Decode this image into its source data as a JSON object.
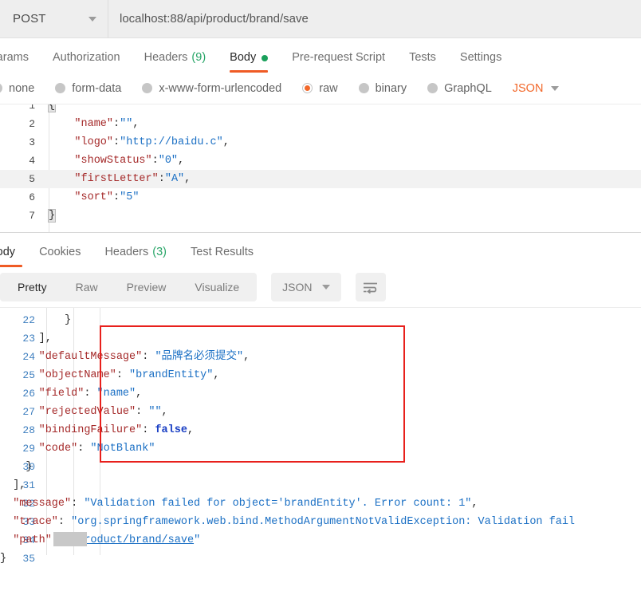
{
  "request": {
    "method": "POST",
    "method_caret_icon": "chevron-down-icon",
    "url": "localhost:88/api/product/brand/save",
    "tabs": [
      {
        "label": "Params",
        "active": false
      },
      {
        "label": "Authorization",
        "active": false
      },
      {
        "label": "Headers",
        "count": "(9)",
        "active": false
      },
      {
        "label": "Body",
        "active": true,
        "dot": true
      },
      {
        "label": "Pre-request Script",
        "active": false
      },
      {
        "label": "Tests",
        "active": false
      },
      {
        "label": "Settings",
        "active": false
      }
    ],
    "body_types": [
      {
        "label": "none",
        "selected": false
      },
      {
        "label": "form-data",
        "selected": false
      },
      {
        "label": "x-www-form-urlencoded",
        "selected": false
      },
      {
        "label": "raw",
        "selected": true
      },
      {
        "label": "binary",
        "selected": false
      },
      {
        "label": "GraphQL",
        "selected": false
      }
    ],
    "format": "JSON",
    "format_caret_icon": "chevron-down-icon",
    "body_lines": [
      {
        "num": "1",
        "segments": [
          {
            "t": "{",
            "c": "bracket"
          }
        ]
      },
      {
        "num": "2",
        "segments": [
          {
            "t": "    ",
            "c": "p"
          },
          {
            "t": "\"name\"",
            "c": "k"
          },
          {
            "t": ":",
            "c": "p"
          },
          {
            "t": "\"\"",
            "c": "s"
          },
          {
            "t": ",",
            "c": "p"
          }
        ]
      },
      {
        "num": "3",
        "segments": [
          {
            "t": "    ",
            "c": "p"
          },
          {
            "t": "\"logo\"",
            "c": "k"
          },
          {
            "t": ":",
            "c": "p"
          },
          {
            "t": "\"http://baidu.c\"",
            "c": "s"
          },
          {
            "t": ",",
            "c": "p"
          }
        ]
      },
      {
        "num": "4",
        "segments": [
          {
            "t": "    ",
            "c": "p"
          },
          {
            "t": "\"showStatus\"",
            "c": "k"
          },
          {
            "t": ":",
            "c": "p"
          },
          {
            "t": "\"0\"",
            "c": "s"
          },
          {
            "t": ",",
            "c": "p"
          }
        ]
      },
      {
        "num": "5",
        "segments": [
          {
            "t": "    ",
            "c": "p"
          },
          {
            "t": "\"firstLetter\"",
            "c": "k"
          },
          {
            "t": ":",
            "c": "p"
          },
          {
            "t": "\"A\"",
            "c": "s"
          },
          {
            "t": ",",
            "c": "p"
          }
        ],
        "highlight": true
      },
      {
        "num": "6",
        "segments": [
          {
            "t": "    ",
            "c": "p"
          },
          {
            "t": "\"sort\"",
            "c": "k"
          },
          {
            "t": ":",
            "c": "p"
          },
          {
            "t": "\"5\"",
            "c": "s"
          }
        ]
      },
      {
        "num": "7",
        "segments": [
          {
            "t": "}",
            "c": "bracket"
          }
        ]
      }
    ]
  },
  "response": {
    "tabs": [
      {
        "label": "Body",
        "active": true
      },
      {
        "label": "Cookies",
        "active": false
      },
      {
        "label": "Headers",
        "count": "(3)",
        "active": false
      },
      {
        "label": "Test Results",
        "active": false
      }
    ],
    "view_modes": [
      {
        "label": "Pretty",
        "active": true
      },
      {
        "label": "Raw",
        "active": false
      },
      {
        "label": "Preview",
        "active": false
      },
      {
        "label": "Visualize",
        "active": false
      }
    ],
    "format": "JSON",
    "format_caret_icon": "chevron-down-icon",
    "wrap_icon": "word-wrap-icon",
    "body_lines": [
      {
        "num": "22",
        "segments": [
          {
            "t": "          }",
            "c": "p"
          }
        ]
      },
      {
        "num": "23",
        "segments": [
          {
            "t": "      ],",
            "c": "p"
          }
        ]
      },
      {
        "num": "24",
        "segments": [
          {
            "t": "      ",
            "c": "p"
          },
          {
            "t": "\"defaultMessage\"",
            "c": "k"
          },
          {
            "t": ": ",
            "c": "p"
          },
          {
            "t": "\"品牌名必须提交\"",
            "c": "s"
          },
          {
            "t": ",",
            "c": "p"
          }
        ]
      },
      {
        "num": "25",
        "segments": [
          {
            "t": "      ",
            "c": "p"
          },
          {
            "t": "\"objectName\"",
            "c": "k"
          },
          {
            "t": ": ",
            "c": "p"
          },
          {
            "t": "\"brandEntity\"",
            "c": "s"
          },
          {
            "t": ",",
            "c": "p"
          }
        ]
      },
      {
        "num": "26",
        "segments": [
          {
            "t": "      ",
            "c": "p"
          },
          {
            "t": "\"field\"",
            "c": "k"
          },
          {
            "t": ": ",
            "c": "p"
          },
          {
            "t": "\"name\"",
            "c": "s"
          },
          {
            "t": ",",
            "c": "p"
          }
        ]
      },
      {
        "num": "27",
        "segments": [
          {
            "t": "      ",
            "c": "p"
          },
          {
            "t": "\"rejectedValue\"",
            "c": "k"
          },
          {
            "t": ": ",
            "c": "p"
          },
          {
            "t": "\"\"",
            "c": "s"
          },
          {
            "t": ",",
            "c": "p"
          }
        ]
      },
      {
        "num": "28",
        "segments": [
          {
            "t": "      ",
            "c": "p"
          },
          {
            "t": "\"bindingFailure\"",
            "c": "k"
          },
          {
            "t": ": ",
            "c": "p"
          },
          {
            "t": "false",
            "c": "b"
          },
          {
            "t": ",",
            "c": "p"
          }
        ]
      },
      {
        "num": "29",
        "segments": [
          {
            "t": "      ",
            "c": "p"
          },
          {
            "t": "\"code\"",
            "c": "k"
          },
          {
            "t": ": ",
            "c": "p"
          },
          {
            "t": "\"NotBlank\"",
            "c": "s"
          }
        ]
      },
      {
        "num": "30",
        "segments": [
          {
            "t": "    }",
            "c": "p"
          }
        ]
      },
      {
        "num": "31",
        "segments": [
          {
            "t": "  ],",
            "c": "p"
          }
        ]
      },
      {
        "num": "32",
        "segments": [
          {
            "t": "  ",
            "c": "p"
          },
          {
            "t": "\"message\"",
            "c": "k"
          },
          {
            "t": ": ",
            "c": "p"
          },
          {
            "t": "\"Validation failed for object='brandEntity'. Error count: 1\"",
            "c": "s"
          },
          {
            "t": ",",
            "c": "p"
          }
        ]
      },
      {
        "num": "33",
        "segments": [
          {
            "t": "  ",
            "c": "p"
          },
          {
            "t": "\"trace\"",
            "c": "k"
          },
          {
            "t": ": ",
            "c": "p"
          },
          {
            "t": "\"org.springframework.web.bind.MethodArgumentNotValidException: Validation fail",
            "c": "s"
          }
        ]
      },
      {
        "num": "34",
        "segments": [
          {
            "t": "  ",
            "c": "p"
          },
          {
            "t": "\"path\"",
            "c": "k"
          },
          {
            "t": ": ",
            "c": "p"
          },
          {
            "t": "\"",
            "c": "s"
          },
          {
            "t": "/product/brand/save",
            "c": "lnk"
          },
          {
            "t": "\"",
            "c": "s"
          }
        ]
      },
      {
        "num": "35",
        "segments": [
          {
            "t": "}",
            "c": "p"
          }
        ]
      }
    ],
    "annotation_color": "#e8201c"
  }
}
